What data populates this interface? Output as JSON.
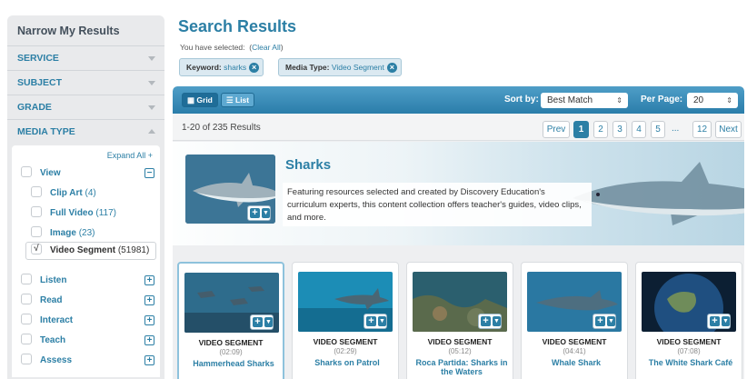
{
  "sidebar": {
    "title": "Narrow My Results",
    "sections": [
      "SERVICE",
      "SUBJECT",
      "GRADE",
      "MEDIA TYPE"
    ],
    "expand_all": "Expand All +",
    "media_types": [
      {
        "label": "View",
        "count": "",
        "control": "−"
      },
      {
        "label": "Clip Art",
        "count": "(4)"
      },
      {
        "label": "Full Video",
        "count": "(117)"
      },
      {
        "label": "Image",
        "count": "(23)"
      },
      {
        "label": "Video Segment",
        "count": "(51981)",
        "checked": "√"
      },
      {
        "label": "Listen",
        "count": "",
        "control": "+"
      },
      {
        "label": "Read",
        "count": "",
        "control": "+"
      },
      {
        "label": "Interact",
        "count": "",
        "control": "+"
      },
      {
        "label": "Teach",
        "count": "",
        "control": "+"
      },
      {
        "label": "Assess",
        "count": "",
        "control": "+"
      }
    ]
  },
  "header": {
    "title": "Search Results",
    "selected_label": "You have selected:",
    "clear_all": "Clear All",
    "filters": [
      {
        "key": "Keyword:",
        "value": "sharks",
        "remove": "×"
      },
      {
        "key": "Media Type:",
        "value": "Video Segment",
        "remove": "×"
      }
    ]
  },
  "toolbar": {
    "grid_label": "Grid",
    "list_label": "List",
    "sort_label": "Sort by:",
    "sort_value": "Best Match",
    "per_page_label": "Per Page:",
    "per_page_value": "20",
    "select_arrow": "⇕"
  },
  "results": {
    "count_text": "1-20 of 235 Results",
    "pagination": [
      "Prev",
      "1",
      "2",
      "3",
      "4",
      "5",
      "...",
      "12",
      "Next"
    ]
  },
  "banner": {
    "title": "Sharks",
    "description": "Featuring resources selected and created by Discovery Education's curriculum experts, this content collection offers teacher's guides, video clips, and more.",
    "add_plus": "+",
    "add_arrow": "▼"
  },
  "cards": [
    {
      "type": "VIDEO SEGMENT",
      "duration": "(02:09)",
      "title": "Hammerhead Sharks"
    },
    {
      "type": "VIDEO SEGMENT",
      "duration": "(02:29)",
      "title": "Sharks on Patrol"
    },
    {
      "type": "VIDEO SEGMENT",
      "duration": "(05:12)",
      "title": "Roca Partida: Sharks in the Waters"
    },
    {
      "type": "VIDEO SEGMENT",
      "duration": "(04:41)",
      "title": "Whale Shark"
    },
    {
      "type": "VIDEO SEGMENT",
      "duration": "(07:08)",
      "title": "The White Shark Café"
    }
  ],
  "colors": {
    "accent": "#2c7fa5",
    "toolbar": "#3a8dba",
    "panel": "#e9eaec"
  }
}
